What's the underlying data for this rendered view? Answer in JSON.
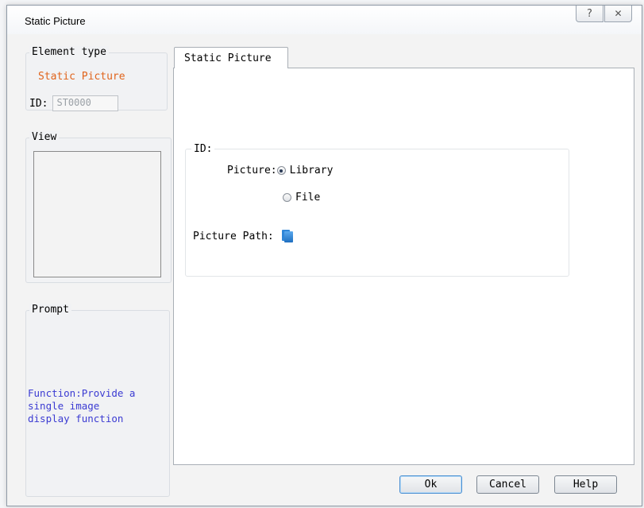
{
  "window": {
    "title": "Static Picture",
    "help_glyph": "?",
    "close_glyph": "✕"
  },
  "element_type": {
    "legend": "Element type",
    "type_value": "Static Picture",
    "id_label": "ID:",
    "id_value": "ST0000"
  },
  "view": {
    "legend": "View"
  },
  "prompt": {
    "legend": "Prompt",
    "text": "Function:Provide a\nsingle image\ndisplay function"
  },
  "tabs": [
    {
      "label": "Static Picture",
      "active": true
    }
  ],
  "form": {
    "group_legend": "ID:",
    "picture_label": "Picture:",
    "picture_options": [
      {
        "label": "Library",
        "selected": true
      },
      {
        "label": "File",
        "selected": false
      }
    ],
    "picture_path_label": "Picture Path:",
    "picture_path_icon": "open-folder-icon"
  },
  "buttons": {
    "ok": "Ok",
    "cancel": "Cancel",
    "help": "Help"
  },
  "colors": {
    "type_value": "#e0641c",
    "prompt_text": "#3b3bd2",
    "folder_icon": "#2f86d8"
  }
}
